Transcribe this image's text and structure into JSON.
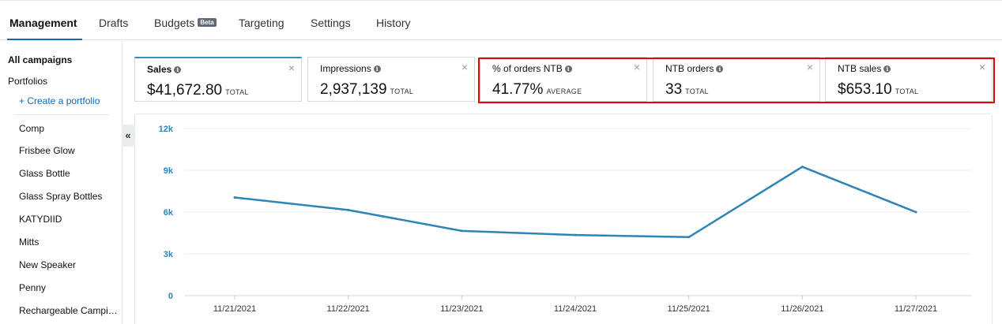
{
  "tabs": [
    {
      "label": "Management",
      "active": true
    },
    {
      "label": "Drafts"
    },
    {
      "label": "Budgets",
      "badge": "Beta"
    },
    {
      "label": "Targeting"
    },
    {
      "label": "Settings"
    },
    {
      "label": "History"
    }
  ],
  "sidebar": {
    "all_campaigns": "All campaigns",
    "portfolios": "Portfolios",
    "create_portfolio": "+ Create a portfolio",
    "collapse_glyph": "«",
    "items": [
      "Comp",
      "Frisbee Glow",
      "Glass Bottle",
      "Glass Spray Bottles",
      "KATYDIID",
      "Mitts",
      "New Speaker",
      "Penny",
      "Rechargeable Camping Lantern"
    ]
  },
  "metrics": [
    {
      "title": "Sales",
      "value": "$41,672.80",
      "unit": "TOTAL",
      "selected": true
    },
    {
      "title": "Impressions",
      "value": "2,937,139",
      "unit": "TOTAL"
    },
    {
      "title": "% of orders NTB",
      "value": "41.77%",
      "unit": "AVERAGE"
    },
    {
      "title": "NTB orders",
      "value": "33",
      "unit": "TOTAL"
    },
    {
      "title": "NTB sales",
      "value": "$653.10",
      "unit": "TOTAL"
    }
  ],
  "icons": {
    "info": "info-icon",
    "close": "close-icon",
    "collapse": "double-chevron-left-icon"
  },
  "colors": {
    "accent": "#0f6cb6",
    "line": "#2e83b7",
    "highlight": "#e60000"
  },
  "chart_data": {
    "type": "line",
    "x": [
      "11/21/2021",
      "11/22/2021",
      "11/23/2021",
      "11/24/2021",
      "11/25/2021",
      "11/26/2021",
      "11/27/2021"
    ],
    "series": [
      {
        "values": [
          7050,
          6150,
          4650,
          4350,
          4200,
          9250,
          6000
        ]
      }
    ],
    "yticks": [
      "0",
      "3k",
      "6k",
      "9k",
      "12k"
    ],
    "ytick_values": [
      0,
      3000,
      6000,
      9000,
      12000
    ],
    "ylim": [
      0,
      12000
    ],
    "grid": true
  }
}
